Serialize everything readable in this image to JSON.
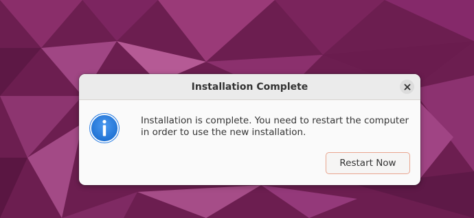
{
  "dialog": {
    "title": "Installation Complete",
    "message": "Installation is complete. You need to restart the computer in order to use the new installation.",
    "restart_label": "Restart Now"
  },
  "icons": {
    "close": "close-icon",
    "info": "info-icon"
  },
  "colors": {
    "wallpaper_base": "#6e1f52",
    "button_focus_border": "#e9a48e",
    "info_icon_blue": "#3584e4"
  }
}
